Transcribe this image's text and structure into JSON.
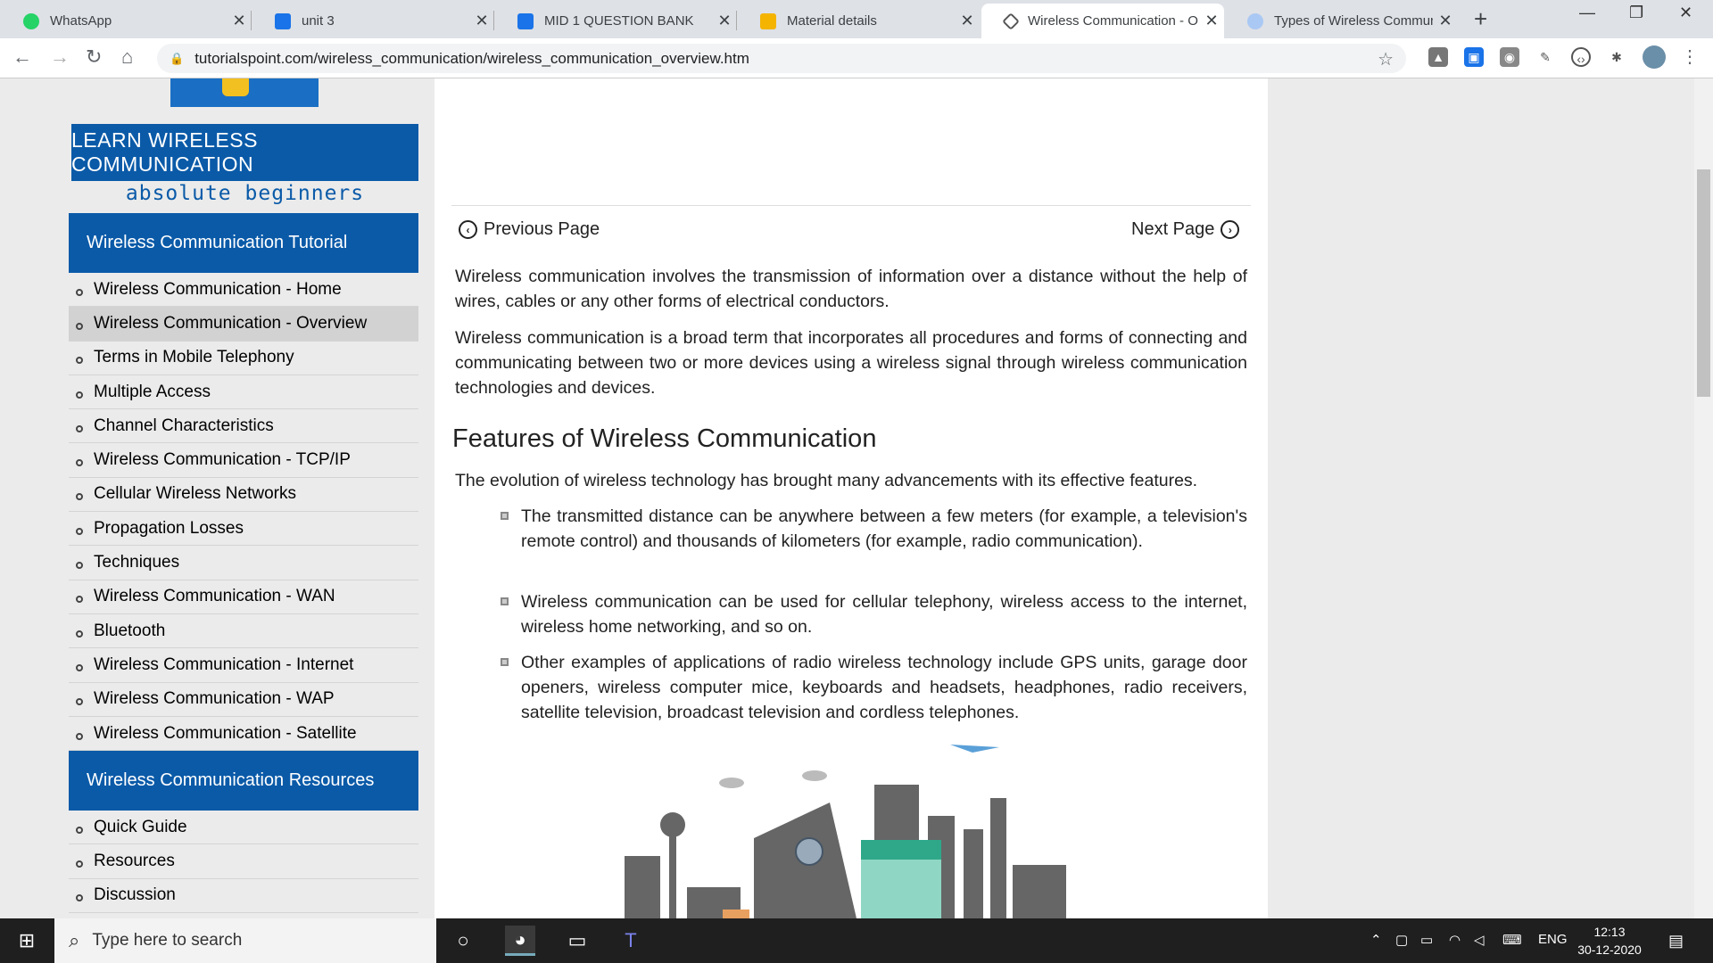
{
  "browser": {
    "tabs": [
      {
        "label": "WhatsApp",
        "favicon_color": "#25d366"
      },
      {
        "label": "unit 3",
        "favicon_color": "#1a73e8"
      },
      {
        "label": "MID 1 QUESTION BANK",
        "favicon_color": "#1a73e8"
      },
      {
        "label": "Material details",
        "favicon_color": "#f4b400"
      },
      {
        "label": "Wireless Communication - O",
        "favicon_color": "#555555"
      },
      {
        "label": "Types of Wireless Communic",
        "favicon_color": "#4285f4"
      }
    ],
    "url": "tutorialspoint.com/wireless_communication/wireless_communication_overview.htm"
  },
  "logo": {
    "title": "LEARN WIRELESS COMMUNICATION",
    "subtitle": "absolute beginners"
  },
  "sidebar": {
    "tutorial_heading": "Wireless Communication Tutorial",
    "tutorial_items": [
      "Wireless Communication - Home",
      "Wireless Communication - Overview",
      "Terms in Mobile Telephony",
      "Multiple Access",
      "Channel Characteristics",
      "Wireless Communication - TCP/IP",
      "Cellular Wireless Networks",
      "Propagation Losses",
      "Techniques",
      "Wireless Communication - WAN",
      "Bluetooth",
      "Wireless Communication - Internet",
      "Wireless Communication - WAP",
      "Wireless Communication - Satellite"
    ],
    "resources_heading": "Wireless Communication Resources",
    "resources_items": [
      "Quick Guide",
      "Resources",
      "Discussion"
    ]
  },
  "main": {
    "prev_label": "Previous Page",
    "next_label": "Next Page",
    "para1": "Wireless communication involves the transmission of information over a distance without the help of wires, cables or any other forms of electrical conductors.",
    "para2": "Wireless communication is a broad term that incorporates all procedures and forms of connecting and communicating between two or more devices using a wireless signal through wireless communication technologies and devices.",
    "heading": "Features of Wireless Communication",
    "intro": "The evolution of wireless technology has brought many advancements with its effective features.",
    "features": [
      "The transmitted distance can be anywhere between a few meters (for example, a television's remote control) and thousands of kilometers (for example, radio communication).",
      "Wireless communication can be used for cellular telephony, wireless access to the internet, wireless home networking, and so on.",
      "Other examples of applications of radio wireless technology include GPS units, garage door openers, wireless computer mice, keyboards and headsets, headphones, radio receivers, satellite television, broadcast television and cordless telephones."
    ]
  },
  "taskbar": {
    "search_placeholder": "Type here to search",
    "language": "ENG",
    "time": "12:13",
    "date": "30-12-2020"
  }
}
